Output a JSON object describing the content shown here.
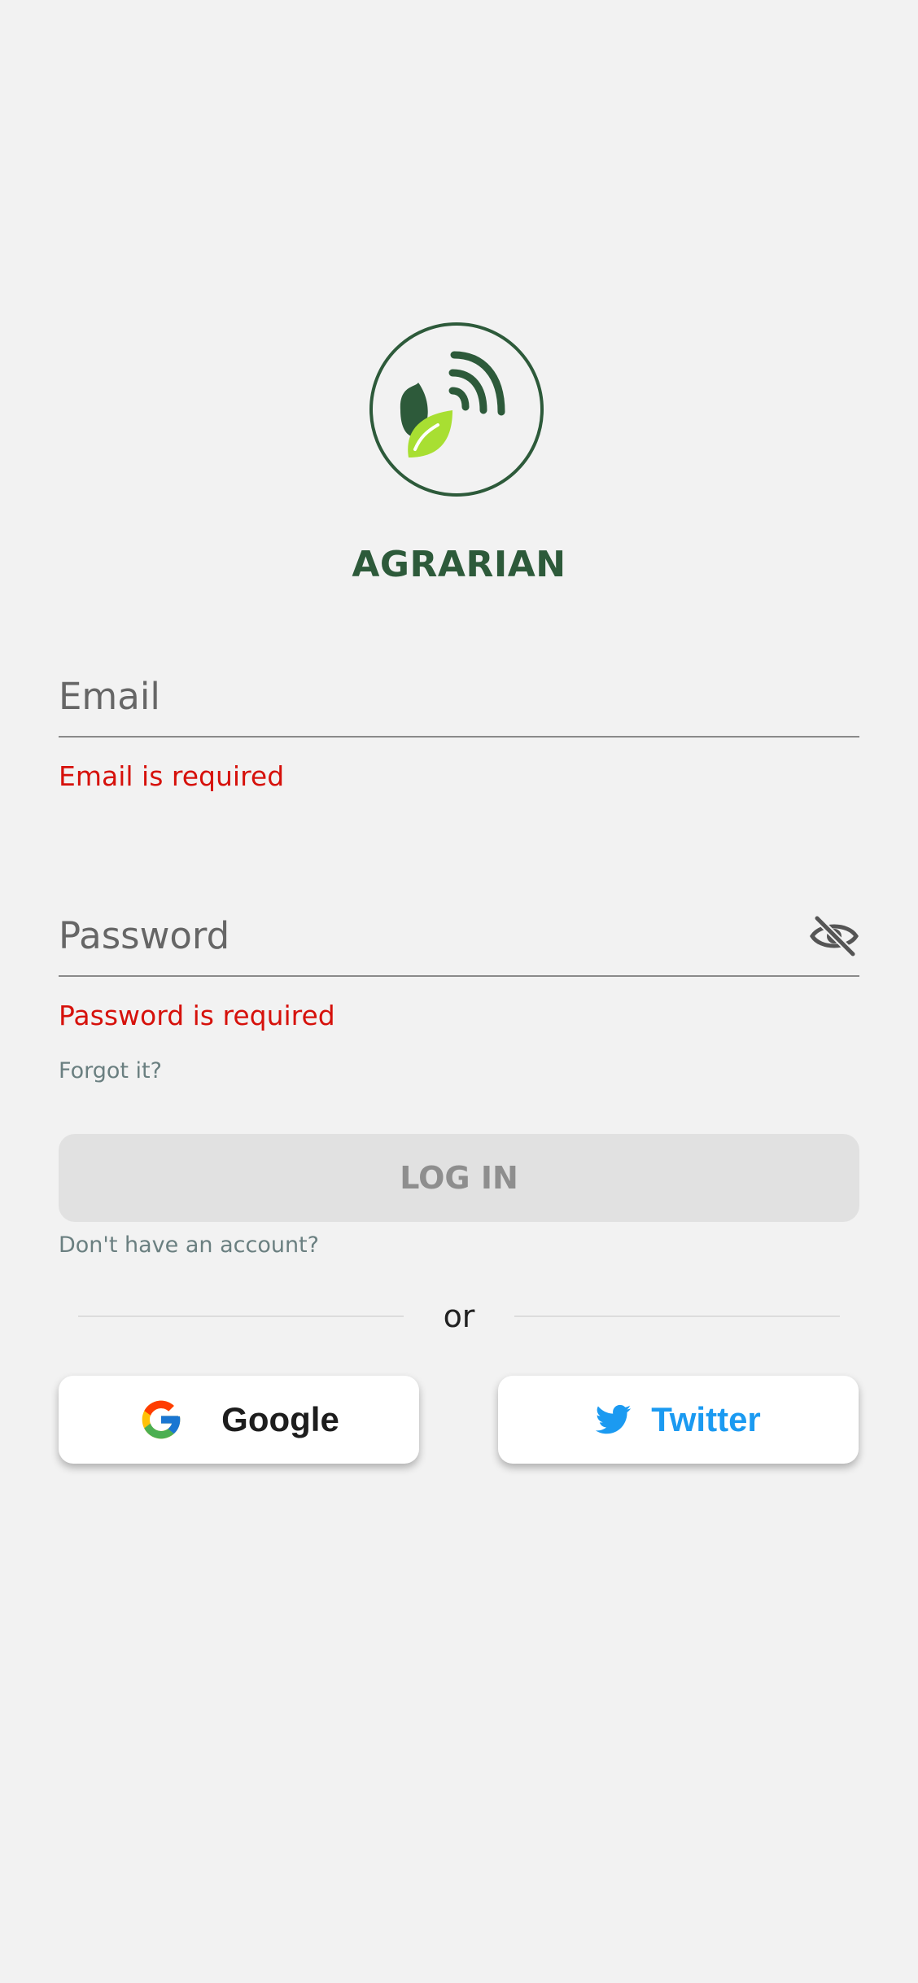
{
  "app": {
    "name": "AGRARIAN",
    "logo_icon": "leaf-signal-logo-icon"
  },
  "email": {
    "placeholder": "Email",
    "value": "",
    "error": "Email is required"
  },
  "password": {
    "placeholder": "Password",
    "value": "",
    "error": "Password is required",
    "visibility_icon": "eye-off-icon"
  },
  "links": {
    "forgot": "Forgot it?",
    "signup": "Don't have an account?"
  },
  "login_button": {
    "label": "LOG IN",
    "enabled": false
  },
  "divider": {
    "label": "or"
  },
  "social": {
    "google": {
      "label": "Google",
      "icon": "google-icon"
    },
    "twitter": {
      "label": "Twitter",
      "icon": "twitter-bird-icon",
      "color": "#1b9af1"
    }
  },
  "colors": {
    "brand": "#2d5a3a",
    "brand_light": "#a8df32",
    "error": "#d6110b",
    "background": "#f2f2f2"
  }
}
